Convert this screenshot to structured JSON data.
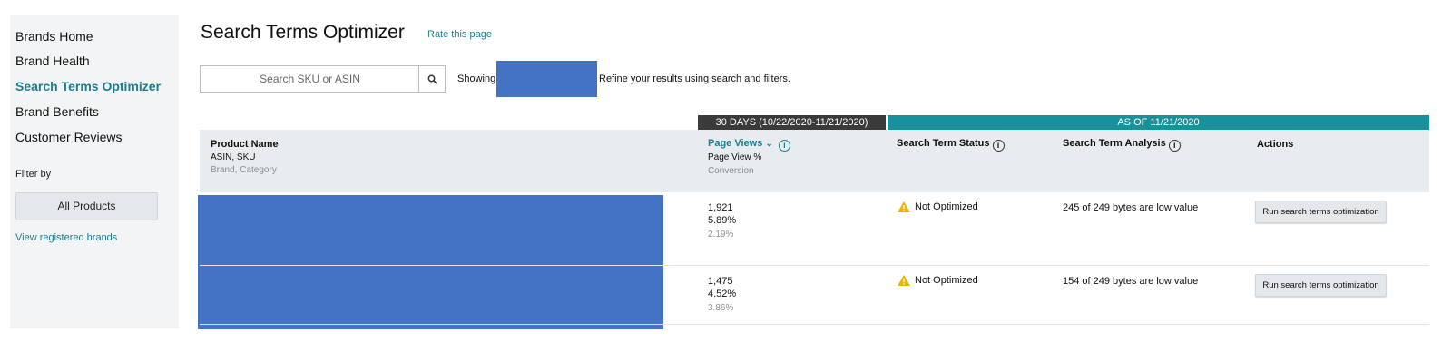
{
  "sidebar": {
    "items": [
      {
        "label": "Brands Home",
        "active": false
      },
      {
        "label": "Brand Health",
        "active": false
      },
      {
        "label": "Search Terms Optimizer",
        "active": true
      },
      {
        "label": "Brand Benefits",
        "active": false
      },
      {
        "label": "Customer Reviews",
        "active": false
      }
    ],
    "filter_label": "Filter by",
    "filter_button": "All Products",
    "registered_link": "View registered brands"
  },
  "header": {
    "title": "Search Terms Optimizer",
    "rate_link": "Rate this page"
  },
  "search": {
    "placeholder": "Search SKU or ASIN",
    "icon": "search-icon",
    "showing_label": "Showing",
    "refine_text": "Refine your results using search and filters."
  },
  "ranges": {
    "thirty_days": "30 DAYS (10/22/2020-11/21/2020)",
    "as_of": "AS OF 11/21/2020"
  },
  "table": {
    "headers": {
      "product_name": "Product Name",
      "product_sub1": "ASIN, SKU",
      "product_sub2": "Brand, Category",
      "page_views": "Page Views",
      "page_views_sub1": "Page View %",
      "page_views_sub2": "Conversion",
      "status": "Search Term Status",
      "analysis": "Search Term Analysis",
      "actions": "Actions"
    },
    "rows": [
      {
        "page_views": "1,921",
        "page_view_pct": "5.89%",
        "conversion": "2.19%",
        "status": "Not Optimized",
        "analysis": "245 of 249 bytes are low value",
        "action": "Run search terms optimization"
      },
      {
        "page_views": "1,475",
        "page_view_pct": "4.52%",
        "conversion": "3.86%",
        "status": "Not Optimized",
        "analysis": "154 of 249 bytes are low value",
        "action": "Run search terms optimization"
      }
    ]
  },
  "colors": {
    "accent": "#1b7f8c",
    "teal_band": "#17929a",
    "dark_band": "#3a3a3a",
    "redaction": "#4472c4",
    "warning": "#f0b400"
  }
}
